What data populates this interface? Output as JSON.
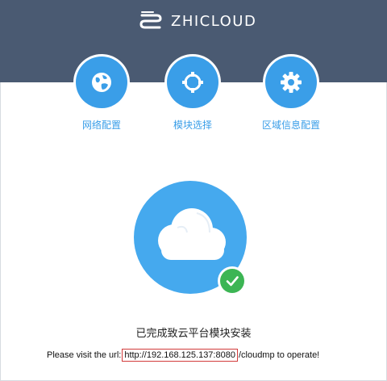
{
  "header": {
    "brand_name": "ZHICLOUD",
    "logo_icon": "zhicloud-logo-icon",
    "background": "#4a5a72"
  },
  "steps": [
    {
      "label": "网络配置",
      "icon": "globe-icon"
    },
    {
      "label": "模块选择",
      "icon": "crosshair-icon"
    },
    {
      "label": "区域信息配置",
      "icon": "gear-icon"
    }
  ],
  "main": {
    "cloud_icon": "cloud-icon",
    "check_icon": "check-icon",
    "status_message": "已完成致云平台模块安装",
    "visit_prefix": "Please visit the url:",
    "url_highlight": "http://192.168.125.137:8080",
    "visit_suffix": "/cloudmp to operate!"
  },
  "colors": {
    "accent": "#3a9ee8",
    "success": "#3cb554",
    "highlight_border": "#d23b3b"
  }
}
